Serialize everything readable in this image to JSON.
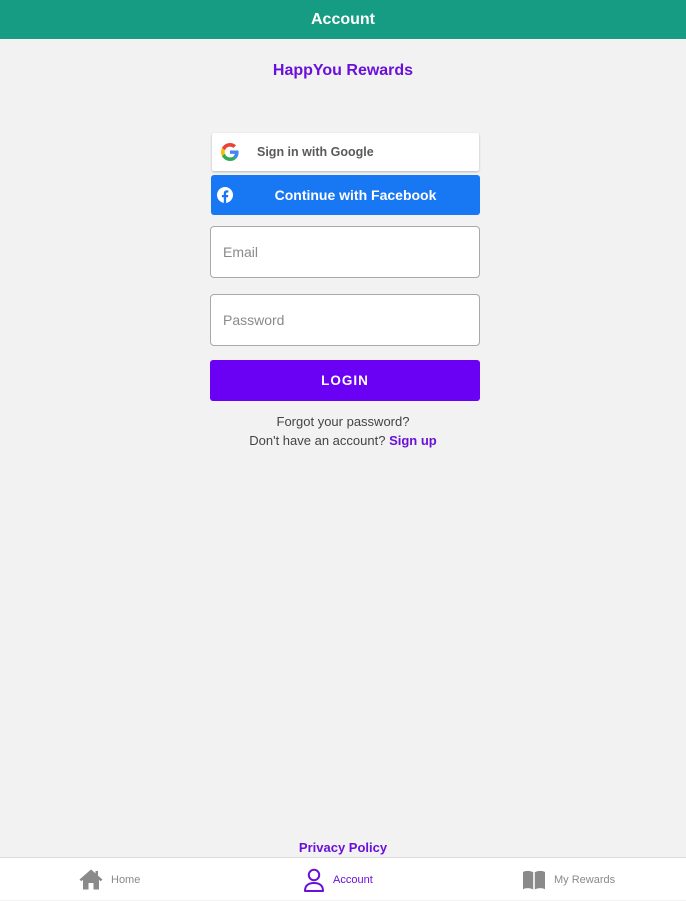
{
  "header": {
    "title": "Account"
  },
  "brand": {
    "title": "HappYou Rewards"
  },
  "auth": {
    "google_label": "Sign in with Google",
    "facebook_label": "Continue with Facebook",
    "email_placeholder": "Email",
    "email_value": "",
    "password_placeholder": "Password",
    "password_value": "",
    "login_label": "LOGIN",
    "forgot_label": "Forgot your password?",
    "no_account_label": "Don't have an account?",
    "signup_label": "Sign up"
  },
  "footer": {
    "privacy_label": "Privacy Policy"
  },
  "tabbar": {
    "items": [
      {
        "label": "Home",
        "icon": "home-icon",
        "active": false
      },
      {
        "label": "Account",
        "icon": "user-icon",
        "active": true
      },
      {
        "label": "My Rewards",
        "icon": "book-icon",
        "active": false
      }
    ]
  },
  "colors": {
    "header_bg": "#169c82",
    "accent": "#6a00f4",
    "brand_text": "#6a10d9",
    "facebook_blue": "#1877f2",
    "page_bg": "#f2f2f3"
  }
}
